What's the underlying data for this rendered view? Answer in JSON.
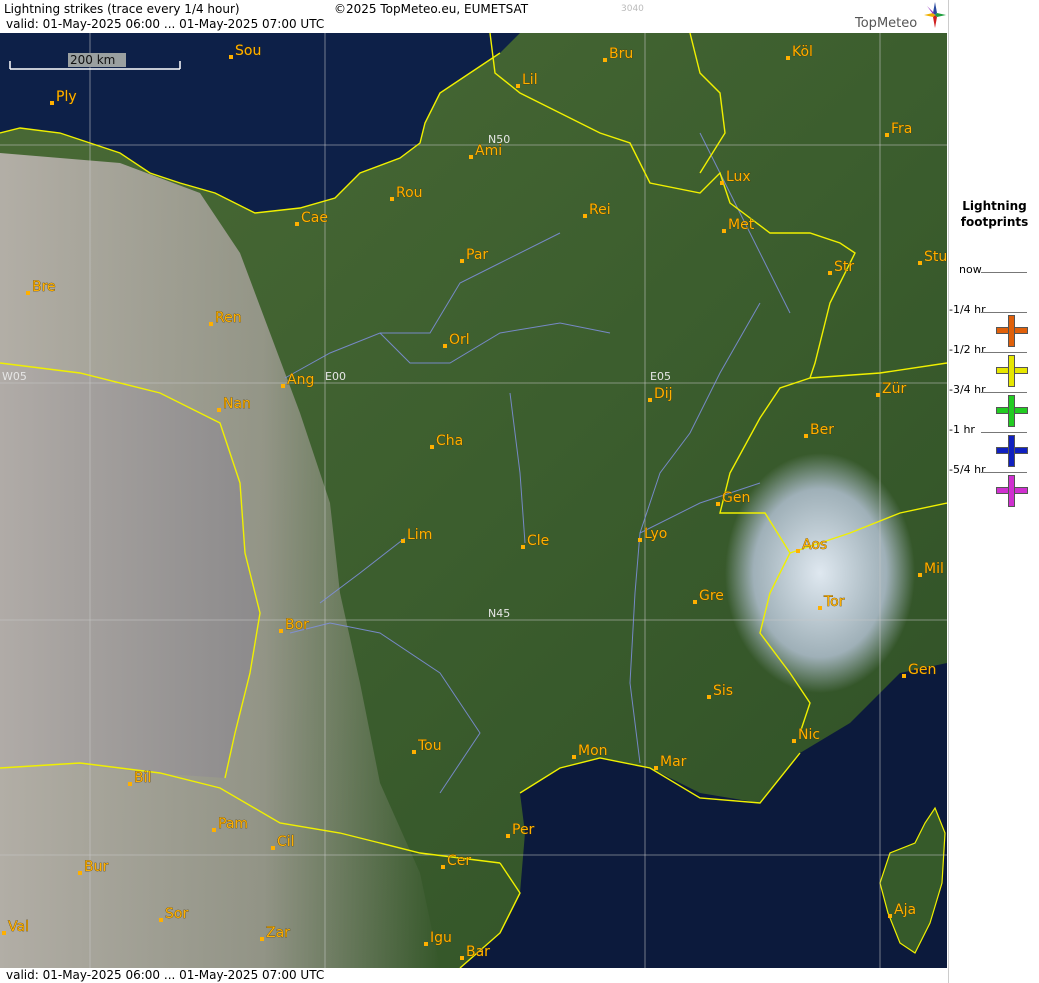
{
  "header": {
    "title": "Lightning strikes (trace every 1/4 hour)",
    "copyright": "©2025 TopMeteo.eu, EUMETSAT",
    "code": "3040",
    "validity": "valid:  01-May-2025 06:00 ... 01-May-2025 07:00 UTC"
  },
  "logo": {
    "text": "TopMeteo",
    "icon": "compass-star-icon"
  },
  "footer": {
    "validity": "valid:  01-May-2025 06:00 ... 01-May-2025 07:00 UTC"
  },
  "scale_bar": {
    "label": "200 km"
  },
  "grid_labels": {
    "n50": "N50",
    "n45": "N45",
    "e00": "E00",
    "e05": "E05",
    "w05": "W05"
  },
  "cities": [
    {
      "name": "Sou"
    },
    {
      "name": "Ply"
    },
    {
      "name": "Lil"
    },
    {
      "name": "Bru"
    },
    {
      "name": "Köl"
    },
    {
      "name": "Ami"
    },
    {
      "name": "Fra"
    },
    {
      "name": "Lux"
    },
    {
      "name": "Rou"
    },
    {
      "name": "Cae"
    },
    {
      "name": "Rei"
    },
    {
      "name": "Met"
    },
    {
      "name": "Par"
    },
    {
      "name": "Stu"
    },
    {
      "name": "Str"
    },
    {
      "name": "Bre"
    },
    {
      "name": "Ren"
    },
    {
      "name": "Orl"
    },
    {
      "name": "Ang"
    },
    {
      "name": "Nan"
    },
    {
      "name": "Dij"
    },
    {
      "name": "Zür"
    },
    {
      "name": "Ber"
    },
    {
      "name": "Cha"
    },
    {
      "name": "Gen"
    },
    {
      "name": "Lim"
    },
    {
      "name": "Cle"
    },
    {
      "name": "Lyo"
    },
    {
      "name": "Aos"
    },
    {
      "name": "Mil"
    },
    {
      "name": "Gre"
    },
    {
      "name": "Tor"
    },
    {
      "name": "Bor"
    },
    {
      "name": "Gen"
    },
    {
      "name": "Sis"
    },
    {
      "name": "Nic"
    },
    {
      "name": "Tou"
    },
    {
      "name": "Mon"
    },
    {
      "name": "Mar"
    },
    {
      "name": "Bil"
    },
    {
      "name": "Pam"
    },
    {
      "name": "Cil"
    },
    {
      "name": "Per"
    },
    {
      "name": "Bur"
    },
    {
      "name": "Cer"
    },
    {
      "name": "Sor"
    },
    {
      "name": "Aja"
    },
    {
      "name": "Val"
    },
    {
      "name": "Zar"
    },
    {
      "name": "Igu"
    },
    {
      "name": "Bar"
    }
  ],
  "legend": {
    "title_line1": "Lightning",
    "title_line2": "footprints",
    "items": [
      {
        "label": "now",
        "color": ""
      },
      {
        "label": "-1/4 hr",
        "color": "#e0600a"
      },
      {
        "label": "-1/2 hr",
        "color": "#e6e600"
      },
      {
        "label": "-3/4 hr",
        "color": "#22cc22"
      },
      {
        "label": "-1 hr",
        "color": "#1020c0"
      },
      {
        "label": "-5/4 hr",
        "color": "#d030d0"
      }
    ]
  },
  "colors": {
    "land": "#3c5a2c",
    "sea": "#0c1a3c",
    "border": "#f0f000",
    "river": "#8090e0",
    "city_label": "#ffb000"
  }
}
